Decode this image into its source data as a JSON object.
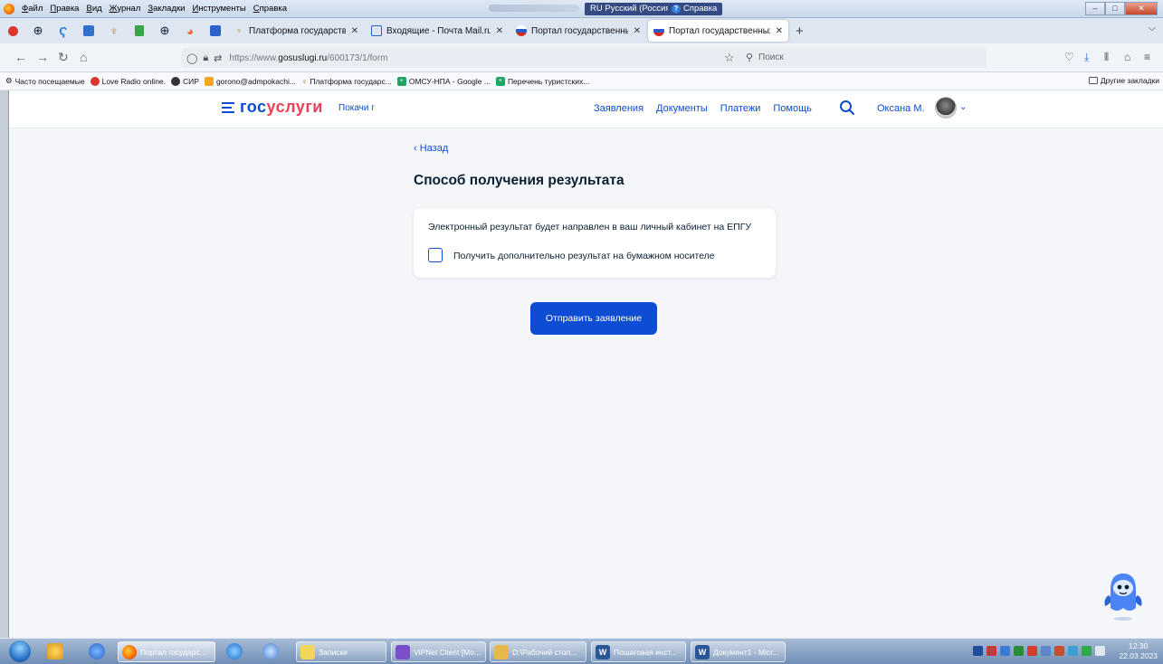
{
  "menubar": {
    "items": [
      "Файл",
      "Правка",
      "Вид",
      "Журнал",
      "Закладки",
      "Инструменты",
      "Справка"
    ],
    "language": "RU Русский (Россия)",
    "help": "Справка"
  },
  "tabs": [
    {
      "title": "Платформа государственных",
      "close": "✕"
    },
    {
      "title": "Входящие - Почта Mail.ru",
      "close": "✕"
    },
    {
      "title": "Портал государственных услу",
      "close": "✕"
    },
    {
      "title": "Портал государственных услу",
      "close": "✕"
    }
  ],
  "navbar": {
    "url_prefix": "https://www.",
    "url_domain": "gosuslugi.ru",
    "url_path": "/600173/1/form",
    "search_placeholder": "Поиск"
  },
  "bookmarks": [
    "Часто посещаемые",
    "Love Radio online.",
    "СИР",
    "gorono@admpokachi...",
    "Платформа государс...",
    "ОМСУ-НПА - Google ...",
    "Перечень туристских..."
  ],
  "bookmarks_other": "Другие закладки",
  "header": {
    "logo_part1": "гос",
    "logo_part2": "услуги",
    "location": "Покачи г",
    "nav": [
      "Заявления",
      "Документы",
      "Платежи",
      "Помощь"
    ],
    "user_name": "Оксана М."
  },
  "form": {
    "back": "‹ Назад",
    "title": "Способ получения результата",
    "info_text": "Электронный результат будет направлен в ваш личный кабинет на ЕПГУ",
    "checkbox_label": "Получить дополнительно результат на бумажном носителе",
    "checkbox_checked": false,
    "submit": "Отправить заявление"
  },
  "taskbar": {
    "tasks": [
      "Портал государс...",
      "Записки",
      "ViPNet Client [Mo...",
      "D:\\Рабочий стол...",
      "Пошаговая инст...",
      "Документ1 - Micr..."
    ],
    "time": "12:30",
    "date": "22.03.2023"
  },
  "colors": {
    "primary": "#0d4cd3",
    "logo_red": "#ee3f58",
    "page_bg": "#f4f6fa"
  }
}
